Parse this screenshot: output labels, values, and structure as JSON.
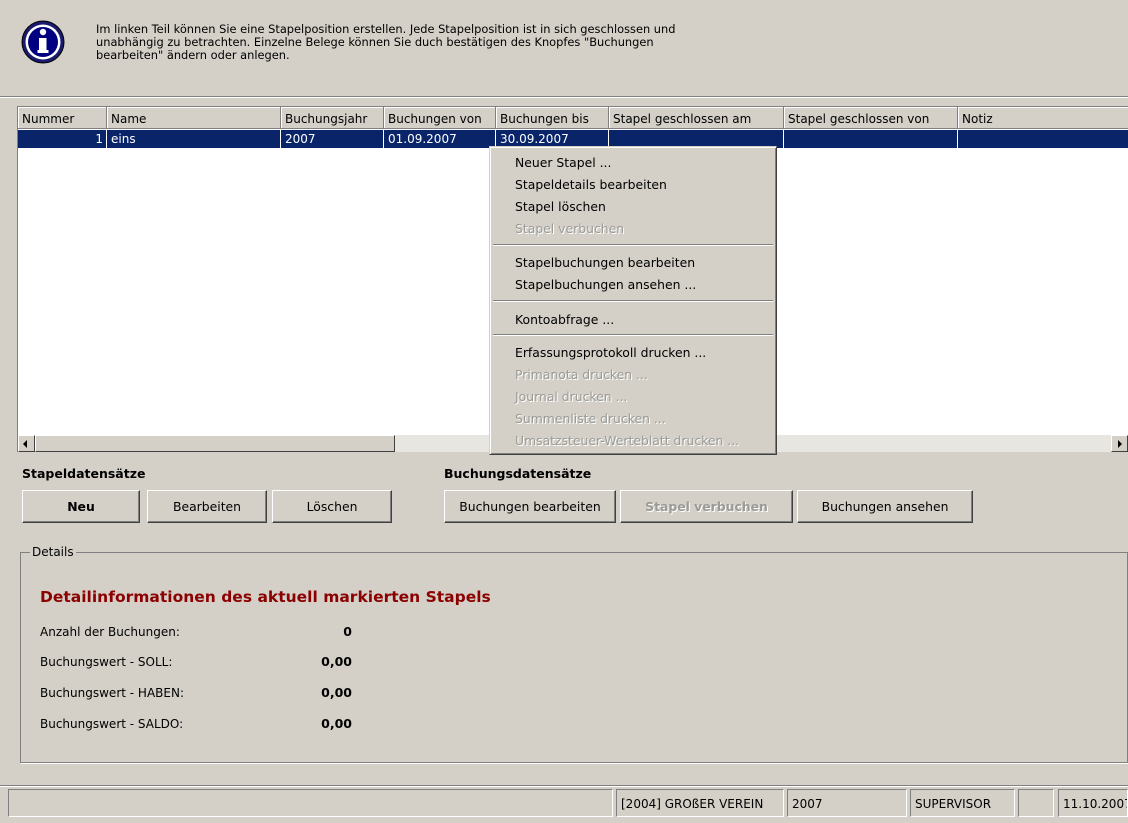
{
  "info": {
    "icon": "info-icon",
    "line1": "Im linken Teil können Sie eine Stapelposition erstellen. Jede Stapelposition ist in sich geschlossen und",
    "line2": "unabhängig zu betrachten. Einzelne Belege können Sie duch bestätigen des Knopfes \"Buchungen",
    "line3": "bearbeiten\" ändern oder anlegen."
  },
  "grid": {
    "columns": [
      "Nummer",
      "Name",
      "Buchungsjahr",
      "Buchungen von",
      "Buchungen bis",
      "Stapel geschlossen am",
      "Stapel geschlossen von",
      "Notiz"
    ],
    "rows": [
      [
        "1",
        "eins",
        "2007",
        "01.09.2007",
        "30.09.2007",
        "",
        "",
        ""
      ]
    ]
  },
  "context_menu": {
    "items": [
      {
        "label": "Neuer Stapel ...",
        "enabled": true
      },
      {
        "label": "Stapeldetails bearbeiten",
        "enabled": true
      },
      {
        "label": "Stapel löschen",
        "enabled": true
      },
      {
        "label": "Stapel verbuchen",
        "enabled": false
      },
      {
        "label": "Stapelbuchungen bearbeiten",
        "enabled": true
      },
      {
        "label": "Stapelbuchungen ansehen ...",
        "enabled": true
      },
      {
        "label": "Kontoabfrage ...",
        "enabled": true
      },
      {
        "label": "Erfassungsprotokoll drucken ...",
        "enabled": true
      },
      {
        "label": "Primanota drucken ...",
        "enabled": false
      },
      {
        "label": "Journal drucken ...",
        "enabled": false
      },
      {
        "label": "Summenliste drucken ...",
        "enabled": false
      },
      {
        "label": "Umsatzsteuer-Werteblatt drucken ...",
        "enabled": false
      }
    ]
  },
  "stapel": {
    "title": "Stapeldatensätze",
    "new_label": "Neu",
    "edit_label": "Bearbeiten",
    "delete_label": "Löschen"
  },
  "buchungen": {
    "title": "Buchungsdatensätze",
    "edit_label": "Buchungen bearbeiten",
    "post_label": "Stapel verbuchen",
    "view_label": "Buchungen ansehen"
  },
  "details": {
    "legend": "Details",
    "title": "Detailinformationen des aktuell markierten Stapels",
    "count_label": "Anzahl der Buchungen:",
    "count_value": "0",
    "soll_label": "Buchungswert - SOLL:",
    "soll_value": "0,00",
    "haben_label": "Buchungswert - HABEN:",
    "haben_value": "0,00",
    "saldo_label": "Buchungswert - SALDO:",
    "saldo_value": "0,00"
  },
  "status": {
    "club": "[2004] GROßER VEREIN",
    "year": "2007",
    "user": "SUPERVISOR",
    "extra": "",
    "date": "11.10.2007"
  }
}
